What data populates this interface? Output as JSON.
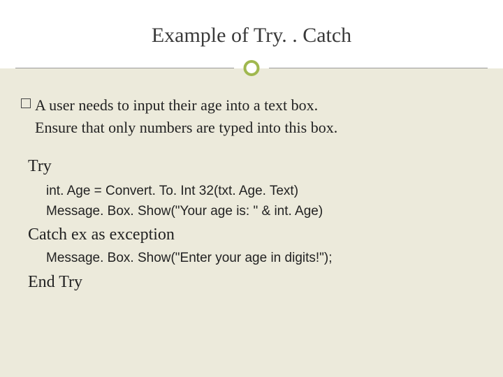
{
  "title": "Example of Try. . Catch",
  "intro_line1": "A user needs to input their age into a text box.",
  "intro_line2": "Ensure that only numbers are typed into this box.",
  "code": {
    "try": "Try",
    "line1": "int. Age = Convert. To. Int 32(txt. Age. Text)",
    "line2": "Message. Box. Show(\"Your age is: \" & int. Age)",
    "catch": "Catch ex as exception",
    "line3": "Message. Box. Show(\"Enter your age in digits!\");",
    "end": "End Try"
  }
}
